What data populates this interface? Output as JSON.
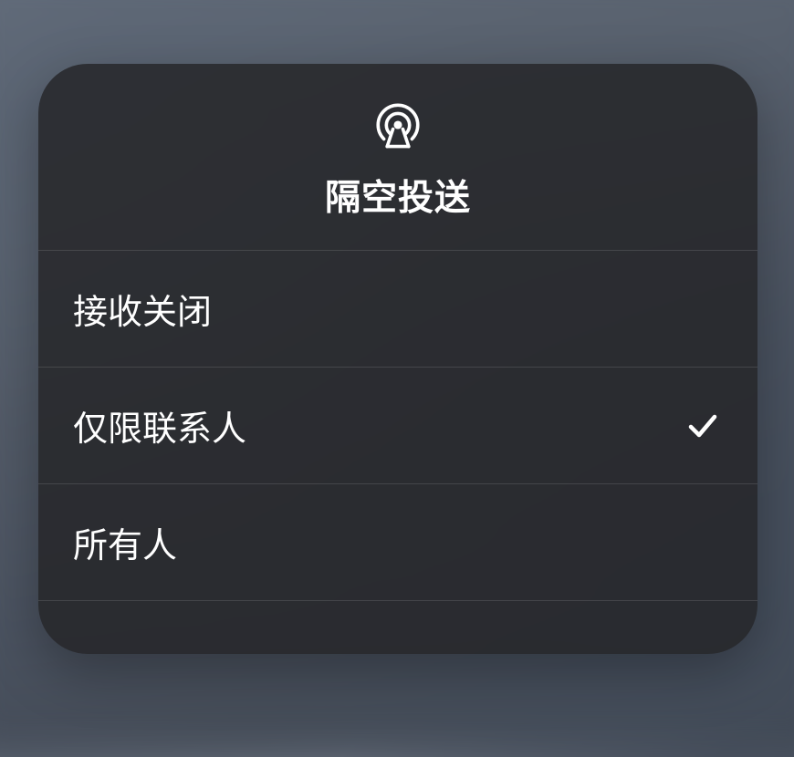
{
  "panel": {
    "title": "隔空投送",
    "icon_name": "airdrop-icon",
    "options": [
      {
        "label": "接收关闭",
        "selected": false
      },
      {
        "label": "仅限联系人",
        "selected": true
      },
      {
        "label": "所有人",
        "selected": false
      }
    ]
  }
}
